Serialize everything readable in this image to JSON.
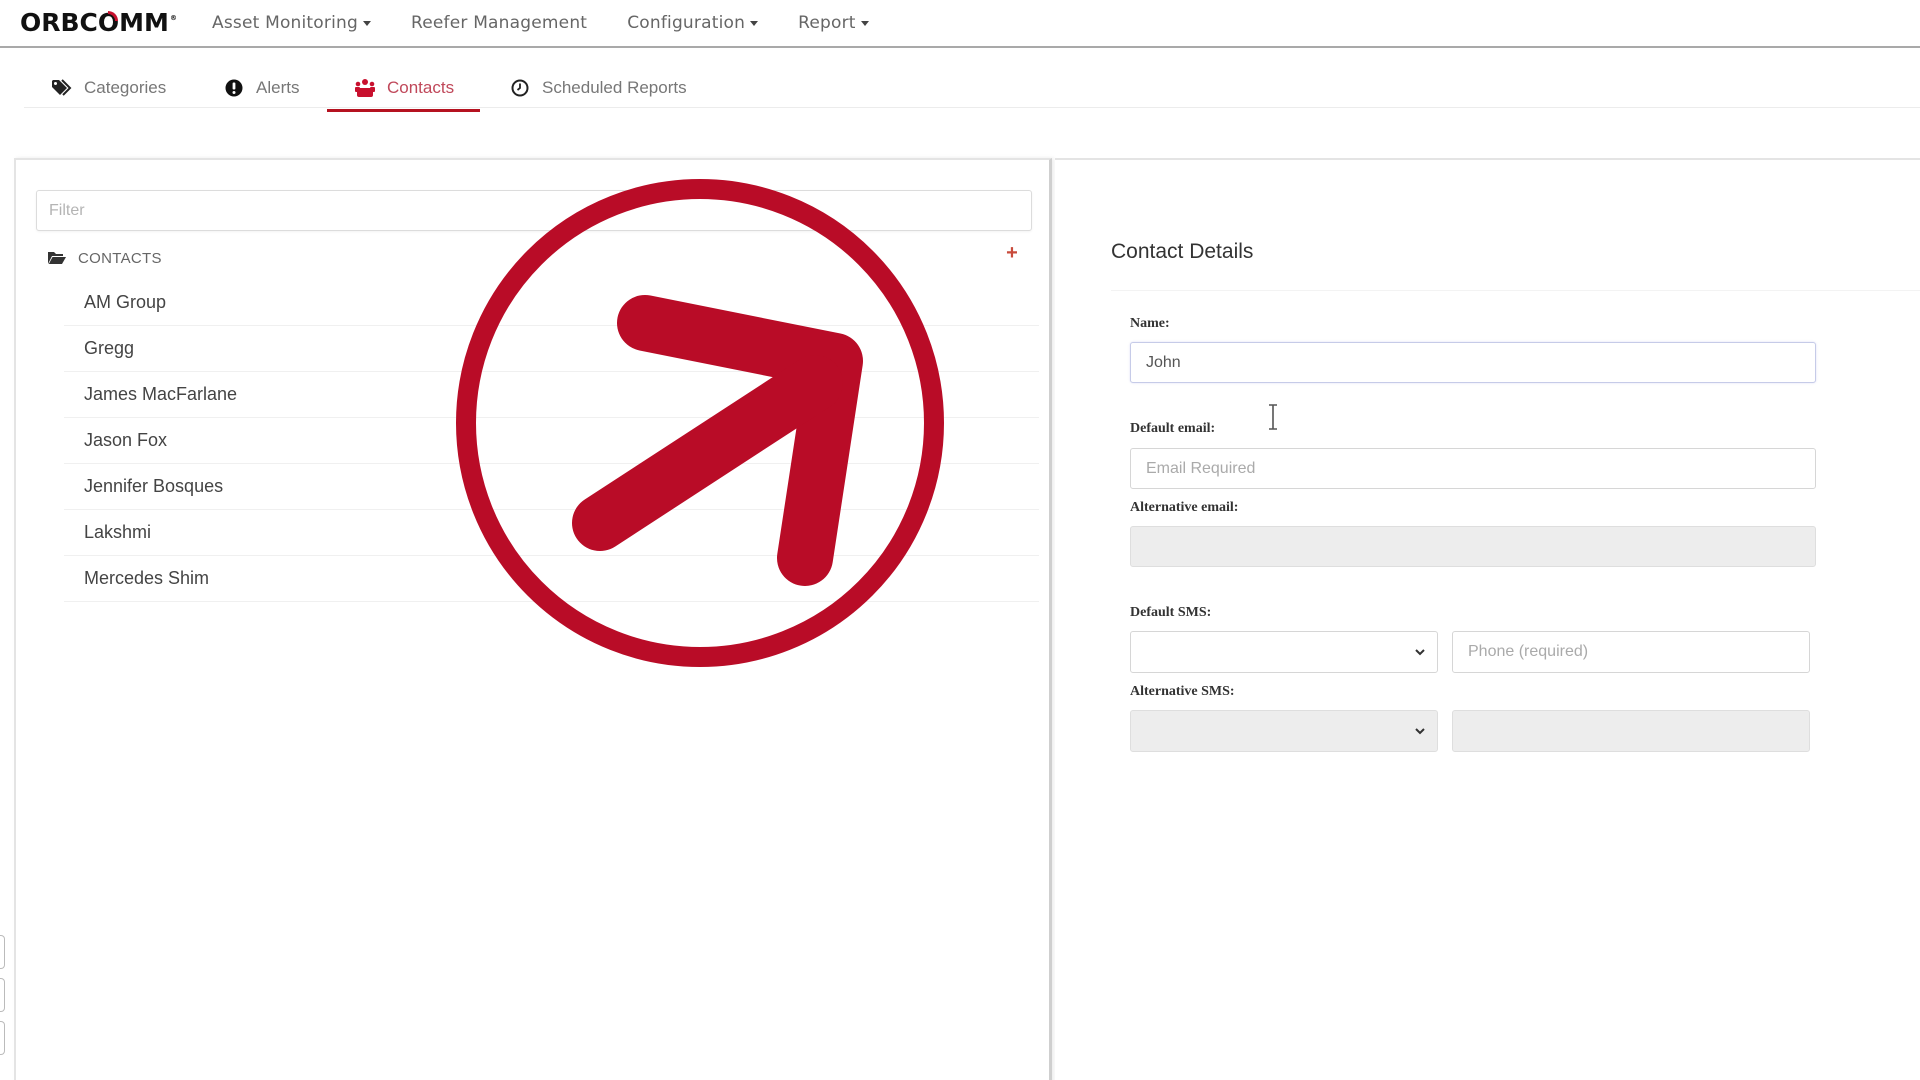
{
  "navbar": {
    "logo_text_a": "ORBC",
    "logo_text_o": "O",
    "logo_text_b": "MM",
    "logo_mark": "®",
    "items": [
      {
        "label": "Asset Monitoring",
        "has_dropdown": true
      },
      {
        "label": "Reefer Management",
        "has_dropdown": false
      },
      {
        "label": "Configuration",
        "has_dropdown": true
      },
      {
        "label": "Report",
        "has_dropdown": true
      }
    ]
  },
  "subtabs": [
    {
      "label": "Categories",
      "icon": "tags-icon",
      "active": false
    },
    {
      "label": "Alerts",
      "icon": "exclamation-circle-icon",
      "active": false
    },
    {
      "label": "Contacts",
      "icon": "users-icon",
      "active": true
    },
    {
      "label": "Scheduled Reports",
      "icon": "clock-icon",
      "active": false
    }
  ],
  "left_panel": {
    "filter_placeholder": "Filter",
    "filter_value": "",
    "contacts_header": "CONTACTS",
    "add_icon": "plus-icon",
    "contacts": [
      "AM Group",
      "Gregg",
      "James MacFarlane",
      "Jason Fox",
      "Jennifer Bosques",
      "Lakshmi",
      "Mercedes Shim"
    ]
  },
  "overlay": {
    "icon": "arrow-up-right-circle-icon",
    "color": "#b90c27"
  },
  "contact_details": {
    "title": "Contact Details",
    "name_label": "Name:",
    "name_value": "John",
    "default_email_label": "Default email:",
    "default_email_placeholder": "Email Required",
    "default_email_value": "",
    "alternative_email_label": "Alternative email:",
    "alternative_email_value": "",
    "default_sms_label": "Default SMS:",
    "default_sms_country": "",
    "default_sms_phone_placeholder": "Phone (required)",
    "alternative_sms_label": "Alternative SMS:",
    "alternative_sms_country": "",
    "alternative_sms_phone": ""
  },
  "colors": {
    "accent": "#b51220",
    "active_tab_text": "#c0485a",
    "add_icon": "#c84b3c"
  }
}
